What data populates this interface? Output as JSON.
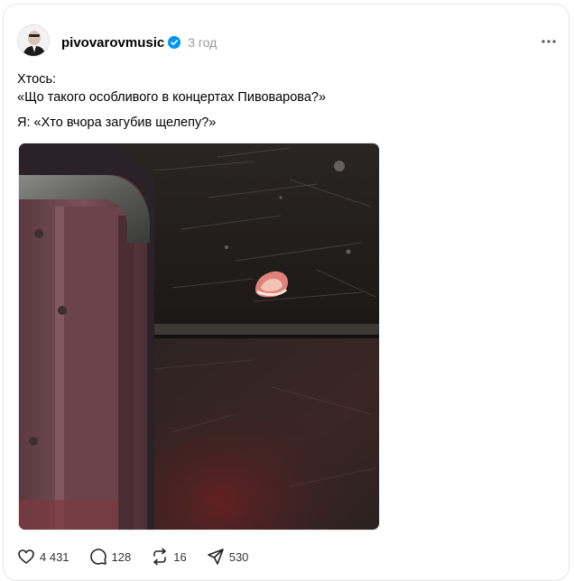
{
  "post": {
    "username": "pivovarovmusic",
    "time": "3 год",
    "text_line1": "Хтось:",
    "text_line2": "«Що такого особливого в концертах Пивоварова?»",
    "text_line3": "Я: «Хто вчора загубив щелепу?»"
  },
  "actions": {
    "likes": "4 431",
    "comments": "128",
    "reposts": "16",
    "shares": "530"
  },
  "icons": {
    "verified": "verified-badge-icon",
    "more": "more-horizontal-icon",
    "like": "heart-icon",
    "comment": "comment-bubble-icon",
    "repost": "repost-icon",
    "share": "send-icon"
  },
  "colors": {
    "accent": "#0095f6",
    "muted": "#999999",
    "border": "#e5e5e5"
  }
}
